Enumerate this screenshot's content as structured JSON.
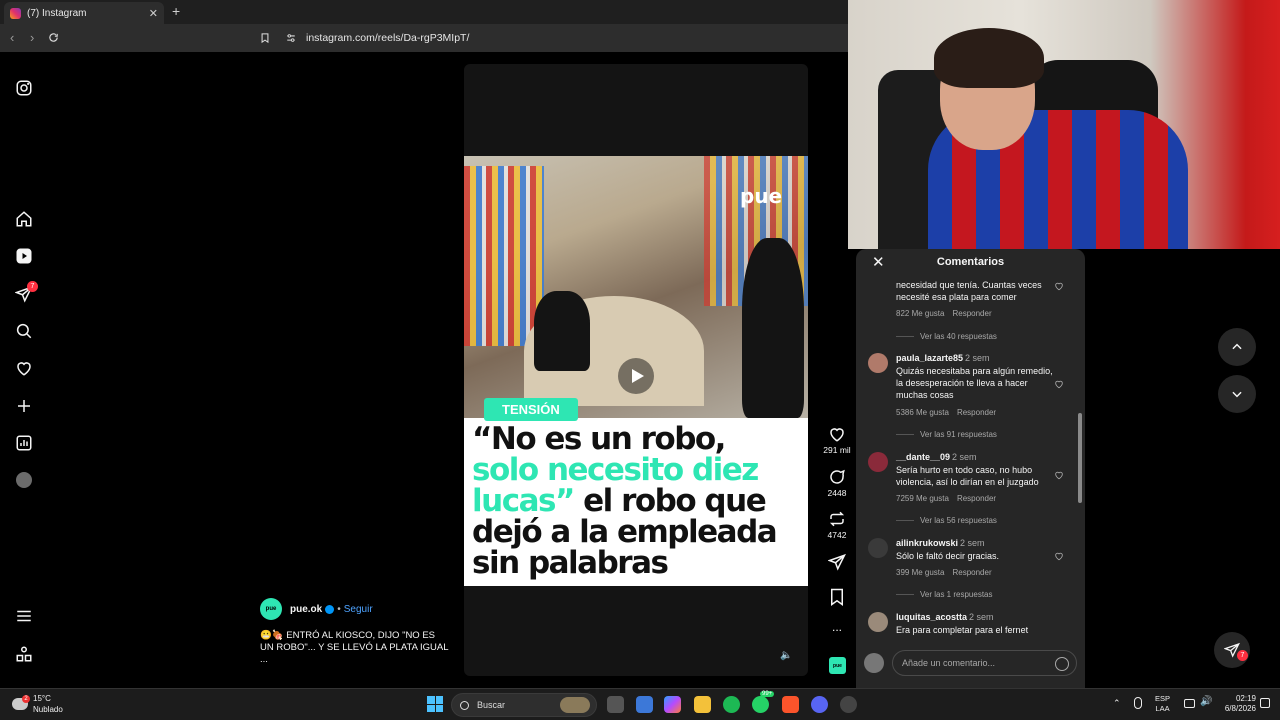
{
  "browser": {
    "tab_title": "(7) Instagram",
    "tab_close": "✕",
    "new_tab": "+",
    "url": "instagram.com/reels/Da-rgP3MIpT/"
  },
  "sidebar": {
    "notifications_badge": "7"
  },
  "reel": {
    "watermark": "pue",
    "tag": "TENSIÓN",
    "headline_part1": "“No es un robo,",
    "headline_highlight": "solo necesito diez lucas”",
    "headline_part2": " el robo que dejó a la empleada sin palabras",
    "likes": "291 mil",
    "comments": "2448",
    "reposts": "4742",
    "more": "...",
    "mute_icon": "🔈",
    "author_avatar_text": "pue",
    "author": "pue.ok",
    "follow": "Seguir",
    "follow_separator": "•",
    "caption_line1": "😬🍖 ENTRÓ AL KIOSCO, DIJO \"NO ES UN ROBO\"... Y SE LLEVÓ LA PLATA IGUAL",
    "caption_more": "..."
  },
  "comments_panel": {
    "title": "Comentarios",
    "close": "✕",
    "items": [
      {
        "user": "",
        "time": "",
        "text": "necesidad que tenía. Cuantas veces necesité esa plata para comer",
        "likes": "822 Me gusta",
        "reply": "Responder",
        "replies": "Ver las 40 respuestas"
      },
      {
        "user": "paula_lazarte85",
        "time": "2 sem",
        "text": "Quizás necesitaba para algún remedio, la desesperación te lleva a hacer muchas cosas",
        "likes": "5386 Me gusta",
        "reply": "Responder",
        "replies": "Ver las 91 respuestas"
      },
      {
        "user": "__dante__09",
        "time": "2 sem",
        "text": "Sería hurto en todo caso, no hubo violencia, así lo dirían en el juzgado",
        "likes": "7259 Me gusta",
        "reply": "Responder",
        "replies": "Ver las 56 respuestas"
      },
      {
        "user": "ailinkrukowski",
        "time": "2 sem",
        "text": "Sólo le faltó decir gracias.",
        "likes": "399 Me gusta",
        "reply": "Responder",
        "replies": "Ver las 1 respuestas"
      },
      {
        "user": "luquitas_acostta",
        "time": "2 sem",
        "text": "Era para completar para el fernet",
        "likes": "",
        "reply": "",
        "replies": ""
      }
    ],
    "input_placeholder": "Añade un comentario..."
  },
  "fab_badge": "7",
  "taskbar": {
    "temp": "15°C",
    "weather": "Nublado",
    "weather_badge": "2",
    "search": "Buscar",
    "lang_top": "ESP",
    "lang_bottom": "LAA",
    "time": "02:19",
    "date": "6/8/2026",
    "whatsapp_badge": "99+"
  },
  "colors": {
    "accent_green": "#2ee6b3",
    "ig_badge": "#ff3040",
    "link_blue": "#4ea3ff"
  }
}
